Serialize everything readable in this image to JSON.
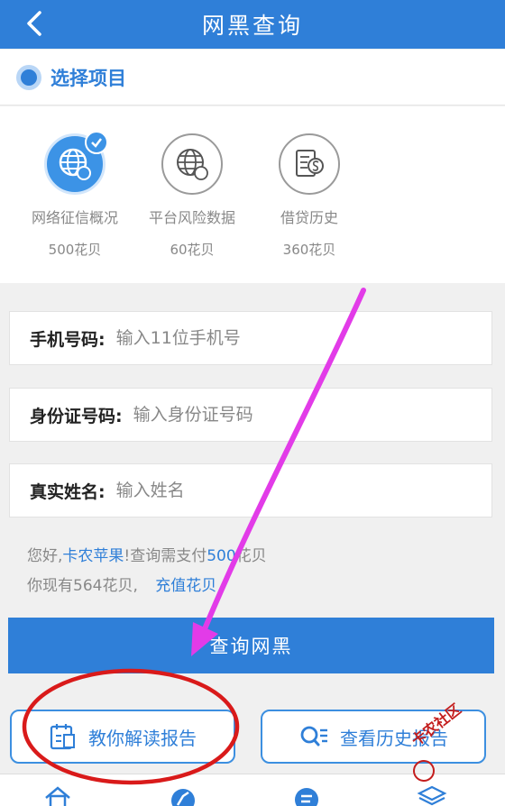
{
  "header": {
    "title": "网黑查询",
    "back_icon": "chevron-left-icon"
  },
  "section": {
    "title": "选择项目"
  },
  "options": [
    {
      "name": "网络征信概况",
      "price": "500花贝",
      "selected": true,
      "icon": "globe-coin-icon"
    },
    {
      "name": "平台风险数据",
      "price": "60花贝",
      "selected": false,
      "icon": "globe-coin-icon"
    },
    {
      "name": "借贷历史",
      "price": "360花贝",
      "selected": false,
      "icon": "document-money-icon"
    }
  ],
  "form": {
    "phone_label": "手机号码:",
    "phone_placeholder": "输入11位手机号",
    "id_label": "身份证号码:",
    "id_placeholder": "输入身份证号码",
    "name_label": "真实姓名:",
    "name_placeholder": "输入姓名"
  },
  "info": {
    "greeting_prefix": "您好,",
    "username": "卡农苹果",
    "greeting_mid": "!查询需支付",
    "cost": "500",
    "cost_unit": "花贝",
    "balance_text": "你现有564花贝,",
    "recharge_link": "充值花贝"
  },
  "buttons": {
    "query": "查询网黑",
    "tutorial": "教你解读报告",
    "history": "查看历史报告"
  },
  "watermark": {
    "text": "卡农社区"
  },
  "colors": {
    "primary": "#2f7fd8",
    "annotation_arrow": "#e23be8",
    "annotation_circle": "#d91a1a"
  }
}
